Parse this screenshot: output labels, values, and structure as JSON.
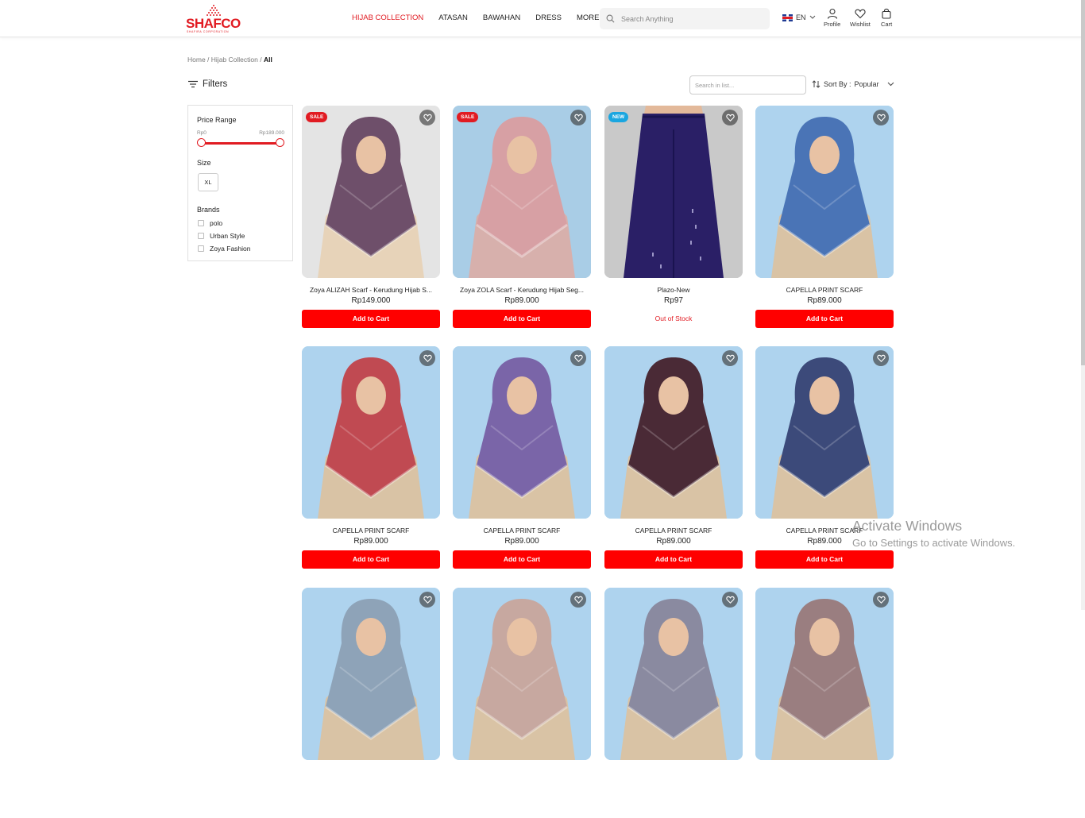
{
  "header": {
    "logo_text": "SHAFCO",
    "logo_tagline": "SHAFIRA CORPORATION",
    "nav": [
      {
        "label": "HIJAB COLLECTION",
        "active": true
      },
      {
        "label": "ATASAN",
        "active": false
      },
      {
        "label": "BAWAHAN",
        "active": false
      },
      {
        "label": "DRESS",
        "active": false
      },
      {
        "label": "MORE",
        "active": false
      }
    ],
    "search_placeholder": "Search Anything",
    "language": "EN",
    "profile_label": "Profile",
    "wishlist_label": "Wishlist",
    "cart_label": "Cart"
  },
  "breadcrumb": {
    "home": "Home",
    "sep1": " / ",
    "section": "Hijab Collection",
    "sep2": " / ",
    "current": "All"
  },
  "toolbar": {
    "filters_label": "Filters",
    "list_search_placeholder": "Search in list...",
    "sort_label": "Sort By :",
    "sort_value": "Popular"
  },
  "filters": {
    "price_range_label": "Price Range",
    "price_min": "Rp0",
    "price_max": "Rp189.000",
    "size_label": "Size",
    "sizes": [
      "XL"
    ],
    "brands_label": "Brands",
    "brands": [
      "polo",
      "Urban Style",
      "Zoya Fashion"
    ]
  },
  "products": [
    {
      "name": "Zoya ALIZAH Scarf - Kerudung Hijab S...",
      "price": "Rp149.000",
      "badge": "SALE",
      "action": "Add to Cart",
      "scarf": "#6e4f6a",
      "bg": "#e4e4e4",
      "body": "#e7d3b9"
    },
    {
      "name": "Zoya ZOLA Scarf - Kerudung Hijab Seg...",
      "price": "Rp89.000",
      "badge": "SALE",
      "action": "Add to Cart",
      "scarf": "#d7a0a4",
      "bg": "#a9cde6",
      "body": "#d7b0ac"
    },
    {
      "name": "Plazo-New",
      "price": "Rp97",
      "badge": "NEW",
      "action": "Out of Stock",
      "scarf": "#2a1f66",
      "bg": "#c9c9c9",
      "body": "#2a1f66"
    },
    {
      "name": "CAPELLA PRINT SCARF",
      "price": "Rp89.000",
      "badge": "",
      "action": "Add to Cart",
      "scarf": "#4a74b6",
      "bg": "#aed3ee",
      "body": "#d9c3a5"
    },
    {
      "name": "CAPELLA PRINT SCARF",
      "price": "Rp89.000",
      "badge": "",
      "action": "Add to Cart",
      "scarf": "#c04a52",
      "bg": "#aed3ee",
      "body": "#d9c3a5"
    },
    {
      "name": "CAPELLA PRINT SCARF",
      "price": "Rp89.000",
      "badge": "",
      "action": "Add to Cart",
      "scarf": "#7a65a8",
      "bg": "#aed3ee",
      "body": "#d9c3a5"
    },
    {
      "name": "CAPELLA PRINT SCARF",
      "price": "Rp89.000",
      "badge": "",
      "action": "Add to Cart",
      "scarf": "#4a2a36",
      "bg": "#aed3ee",
      "body": "#d9c3a5"
    },
    {
      "name": "CAPELLA PRINT SCARF",
      "price": "Rp89.000",
      "badge": "",
      "action": "Add to Cart",
      "scarf": "#3c4a7a",
      "bg": "#aed3ee",
      "body": "#d9c3a5"
    },
    {
      "name": "",
      "price": "",
      "badge": "",
      "action": "",
      "scarf": "#8ea3b8",
      "bg": "#aed3ee",
      "body": "#d9c3a5"
    },
    {
      "name": "",
      "price": "",
      "badge": "",
      "action": "",
      "scarf": "#c7a8a0",
      "bg": "#aed3ee",
      "body": "#d9c3a5"
    },
    {
      "name": "",
      "price": "",
      "badge": "",
      "action": "",
      "scarf": "#8a8aa0",
      "bg": "#aed3ee",
      "body": "#d9c3a5"
    },
    {
      "name": "",
      "price": "",
      "badge": "",
      "action": "",
      "scarf": "#9a7e80",
      "bg": "#aed3ee",
      "body": "#d9c3a5"
    }
  ],
  "colors": {
    "brand_red": "#e11b22",
    "button_red": "#ff0000",
    "sale_badge": "#e11b22",
    "new_badge": "#1aa6e0"
  },
  "watermark": {
    "line1": "Activate Windows",
    "line2": "Go to Settings to activate Windows."
  }
}
